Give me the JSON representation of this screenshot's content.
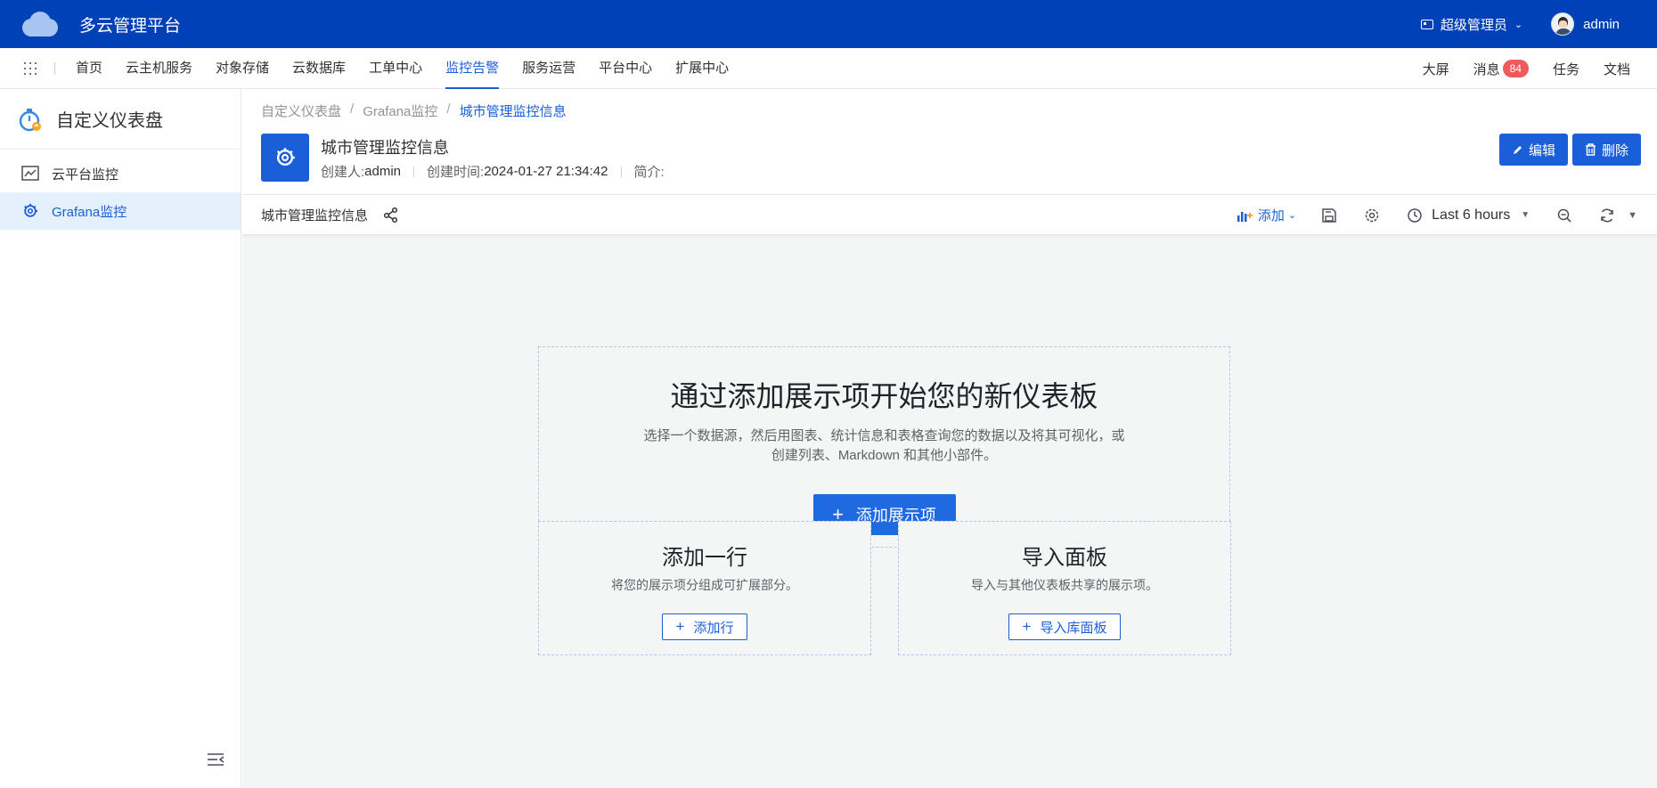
{
  "app": {
    "title": "多云管理平台"
  },
  "header": {
    "role": "超级管理员",
    "user": "admin"
  },
  "nav": {
    "items": [
      "首页",
      "云主机服务",
      "对象存储",
      "云数据库",
      "工单中心",
      "监控告警",
      "服务运营",
      "平台中心",
      "扩展中心"
    ],
    "active": "监控告警",
    "right": {
      "screen": "大屏",
      "messages": "消息",
      "message_count": "84",
      "tasks": "任务",
      "docs": "文档"
    }
  },
  "sidebar": {
    "title": "自定义仪表盘",
    "items": [
      {
        "label": "云平台监控",
        "icon": "line-chart-icon",
        "active": false
      },
      {
        "label": "Grafana监控",
        "icon": "grafana-icon",
        "active": true
      }
    ]
  },
  "breadcrumb": [
    "自定义仪表盘",
    "Grafana监控",
    "城市管理监控信息"
  ],
  "dashboard": {
    "title": "城市管理监控信息",
    "creator_label": "创建人:",
    "creator": "admin",
    "created_label": "创建时间:",
    "created": "2024-01-27 21:34:42",
    "desc_label": "简介:",
    "edit_label": "编辑",
    "delete_label": "删除"
  },
  "toolbar": {
    "name": "城市管理监控信息",
    "add_label": "添加",
    "time_range": "Last 6 hours"
  },
  "empty": {
    "heading": "通过添加展示项开始您的新仪表板",
    "description": "选择一个数据源，然后用图表、统计信息和表格查询您的数据以及将其可视化，或创建列表、Markdown 和其他小部件。",
    "add_panel": "添加展示项",
    "row_title": "添加一行",
    "row_desc": "将您的展示项分组成可扩展部分。",
    "row_button": "添加行",
    "import_title": "导入面板",
    "import_desc": "导入与其他仪表板共享的展示项。",
    "import_button": "导入库面板"
  },
  "colors": {
    "brand": "#0041b8",
    "primary": "#1a5ed8",
    "badge": "#f05a5a"
  }
}
